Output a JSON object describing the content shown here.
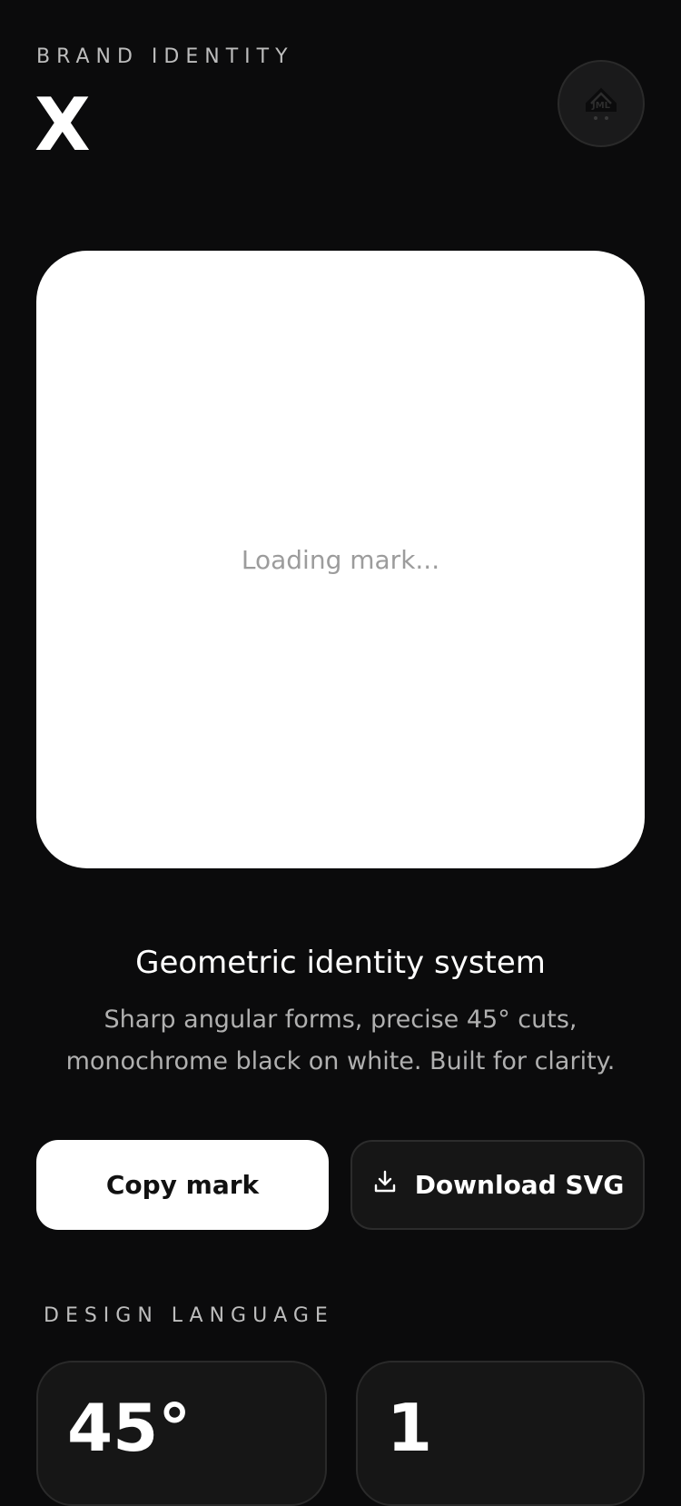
{
  "header": {
    "eyebrow": "BRAND IDENTITY",
    "mark_title": "X",
    "avatar_icon": "storefront-logo-icon"
  },
  "mark_card": {
    "loading_text": "Loading mark..."
  },
  "intro": {
    "headline": "Geometric identity system",
    "description": "Sharp angular forms, precise 45° cuts, monochrome black on white. Built for clarity."
  },
  "actions": {
    "copy_label": "Copy mark",
    "download_label": "Download SVG",
    "download_icon": "download-icon"
  },
  "design_language": {
    "label": "DESIGN LANGUAGE",
    "stats": [
      {
        "value": "45°"
      },
      {
        "value": "1"
      }
    ]
  },
  "colors": {
    "background": "#0b0b0c",
    "card": "#ffffff",
    "surface": "#161616",
    "muted_text": "#b0b0b0"
  }
}
